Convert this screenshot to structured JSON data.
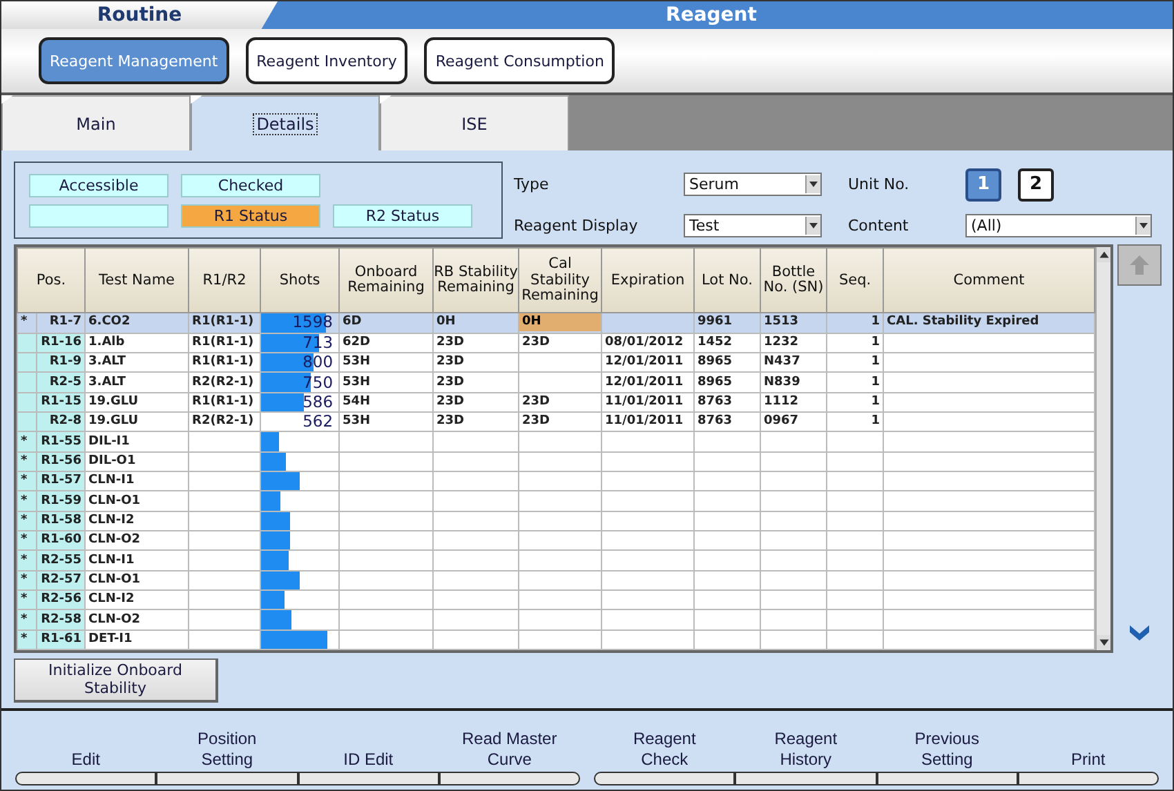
{
  "header": {
    "section": "Routine",
    "title": "Reagent"
  },
  "mode_buttons": [
    {
      "label": "Reagent Management",
      "selected": true
    },
    {
      "label": "Reagent Inventory",
      "selected": false
    },
    {
      "label": "Reagent Consumption",
      "selected": false
    }
  ],
  "tabs": [
    {
      "label": "Main",
      "selected": false
    },
    {
      "label": "Details",
      "selected": true
    },
    {
      "label": "ISE",
      "selected": false
    }
  ],
  "legend": [
    {
      "label": "Accessible",
      "color": "#ccffff"
    },
    {
      "label": "Checked",
      "color": "#ccffff"
    },
    {
      "color": "#ccffff"
    },
    {
      "label": "R1 Status",
      "color": "#f5a742"
    },
    {
      "label": "R2 Status",
      "color": "#ccffff"
    }
  ],
  "filters": {
    "type": {
      "label": "Type",
      "value": "Serum"
    },
    "reagent_display": {
      "label": "Reagent Display",
      "value": "Test"
    },
    "unit_no": {
      "label": "Unit No.",
      "units": [
        {
          "label": "1",
          "selected": true
        },
        {
          "label": "2",
          "selected": false
        }
      ]
    },
    "content": {
      "label": "Content",
      "value": "(All)"
    }
  },
  "table": {
    "columns": [
      "Pos.",
      "Test Name",
      "R1/R2",
      "Shots",
      "Onboard Remaining",
      "RB Stability Remaining",
      "Cal Stability Remaining",
      "Expiration",
      "Lot No.",
      "Bottle No. (SN)",
      "Seq.",
      "Comment"
    ],
    "rows": [
      {
        "mark": "*",
        "pos": "R1-7",
        "test": "6.CO2",
        "r1r2": "R1(R1-1)",
        "shots": "1598",
        "level": 0.84,
        "onboard": "6D",
        "rb": "0H",
        "cal": "0H",
        "cal_alert": true,
        "lot": "9961",
        "bottle": "1513",
        "seq": "1",
        "comment": "CAL. Stability Expired",
        "selected": true
      },
      {
        "pos": "R1-16",
        "test": "1.Alb",
        "r1r2": "R1(R1-1)",
        "shots": "713",
        "level": 0.75,
        "onboard": "62D",
        "rb": "23D",
        "cal": "23D",
        "cal_alert": false,
        "expiration": "08/01/2012",
        "lot": "1452",
        "bottle": "1232",
        "seq": "1",
        "selected": false
      },
      {
        "pos": "R1-9",
        "test": "3.ALT",
        "r1r2": "R1(R1-1)",
        "shots": "800",
        "level": 0.68,
        "onboard": "53H",
        "rb": "23D",
        "cal_alert": false,
        "expiration": "12/01/2011",
        "lot": "8965",
        "bottle": "N437",
        "seq": "1",
        "selected": false
      },
      {
        "pos": "R2-5",
        "test": "3.ALT",
        "r1r2": "R2(R2-1)",
        "shots": "750",
        "level": 0.65,
        "onboard": "53H",
        "rb": "23D",
        "cal_alert": false,
        "expiration": "12/01/2011",
        "lot": "8965",
        "bottle": "N839",
        "seq": "1",
        "selected": false
      },
      {
        "pos": "R1-15",
        "test": "19.GLU",
        "r1r2": "R1(R1-1)",
        "shots": "586",
        "level": 0.55,
        "onboard": "54H",
        "rb": "23D",
        "cal": "23D",
        "cal_alert": false,
        "expiration": "11/01/2011",
        "lot": "8763",
        "bottle": "1112",
        "seq": "1",
        "selected": false
      },
      {
        "pos": "R2-8",
        "test": "19.GLU",
        "r1r2": "R2(R2-1)",
        "shots": "562",
        "onboard": "53H",
        "rb": "23D",
        "cal": "23D",
        "cal_alert": false,
        "expiration": "11/01/2011",
        "lot": "8763",
        "bottle": "0967",
        "seq": "1",
        "selected": false
      },
      {
        "mark": "*",
        "pos": "R1-55",
        "test": "DIL-I1",
        "level": 0.24,
        "cal_alert": false,
        "selected": false
      },
      {
        "mark": "*",
        "pos": "R1-56",
        "test": "DIL-O1",
        "level": 0.32,
        "cal_alert": false,
        "selected": false
      },
      {
        "mark": "*",
        "pos": "R1-57",
        "test": "CLN-I1",
        "level": 0.5,
        "cal_alert": false,
        "selected": false
      },
      {
        "mark": "*",
        "pos": "R1-59",
        "test": "CLN-O1",
        "level": 0.25,
        "cal_alert": false,
        "selected": false
      },
      {
        "mark": "*",
        "pos": "R1-58",
        "test": "CLN-I2",
        "level": 0.38,
        "cal_alert": false,
        "selected": false
      },
      {
        "mark": "*",
        "pos": "R1-60",
        "test": "CLN-O2",
        "level": 0.37,
        "cal_alert": false,
        "selected": false
      },
      {
        "mark": "*",
        "pos": "R2-55",
        "test": "CLN-I1",
        "level": 0.35,
        "cal_alert": false,
        "selected": false
      },
      {
        "mark": "*",
        "pos": "R2-57",
        "test": "CLN-O1",
        "level": 0.5,
        "cal_alert": false,
        "selected": false
      },
      {
        "mark": "*",
        "pos": "R2-56",
        "test": "CLN-I2",
        "level": 0.31,
        "cal_alert": false,
        "selected": false
      },
      {
        "mark": "*",
        "pos": "R2-58",
        "test": "CLN-O2",
        "level": 0.4,
        "cal_alert": false,
        "selected": false
      },
      {
        "mark": "*",
        "pos": "R1-61",
        "test": "DET-I1",
        "level": 0.85,
        "cal_alert": false,
        "selected": false
      }
    ]
  },
  "init_button": "Initialize Onboard Stability",
  "footer_groups": [
    [
      "Edit",
      "Position Setting",
      "ID Edit",
      "Read Master Curve"
    ],
    [
      "Reagent Check",
      "Reagent History",
      "Previous Setting",
      "Print"
    ]
  ]
}
